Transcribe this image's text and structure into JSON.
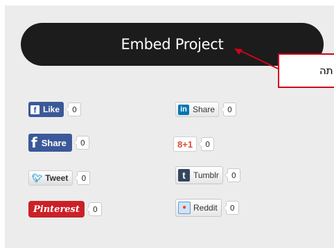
{
  "embed_button": {
    "label": "Embed Project"
  },
  "callout": {
    "text": "תה"
  },
  "share_widgets": {
    "left": [
      {
        "name": "facebook-like",
        "label": "Like",
        "icon": "facebook-icon",
        "count": "0"
      },
      {
        "name": "facebook-share",
        "label": "Share",
        "icon": "facebook-icon",
        "count": "0"
      },
      {
        "name": "twitter-tweet",
        "label": "Tweet",
        "icon": "twitter-bird-icon",
        "count": "0"
      },
      {
        "name": "pinterest",
        "label": "Pinterest",
        "icon": "pinterest-icon",
        "count": "0"
      }
    ],
    "right": [
      {
        "name": "linkedin-share",
        "label": "Share",
        "icon": "linkedin-icon",
        "count": "0"
      },
      {
        "name": "google-plus",
        "label": "8+1",
        "icon": "google-plus-icon",
        "count": "0"
      },
      {
        "name": "tumblr",
        "label": "Tumblr",
        "icon": "tumblr-icon",
        "count": "0"
      },
      {
        "name": "reddit",
        "label": "Reddit",
        "icon": "reddit-alien-icon",
        "count": "0"
      }
    ]
  },
  "colors": {
    "facebook": "#3b5998",
    "pinterest": "#cb2027",
    "linkedin": "#0077b5",
    "google_plus": "#dd4b39",
    "tumblr": "#34465d",
    "twitter": "#2ea1de",
    "callout_border": "#d0021b"
  }
}
